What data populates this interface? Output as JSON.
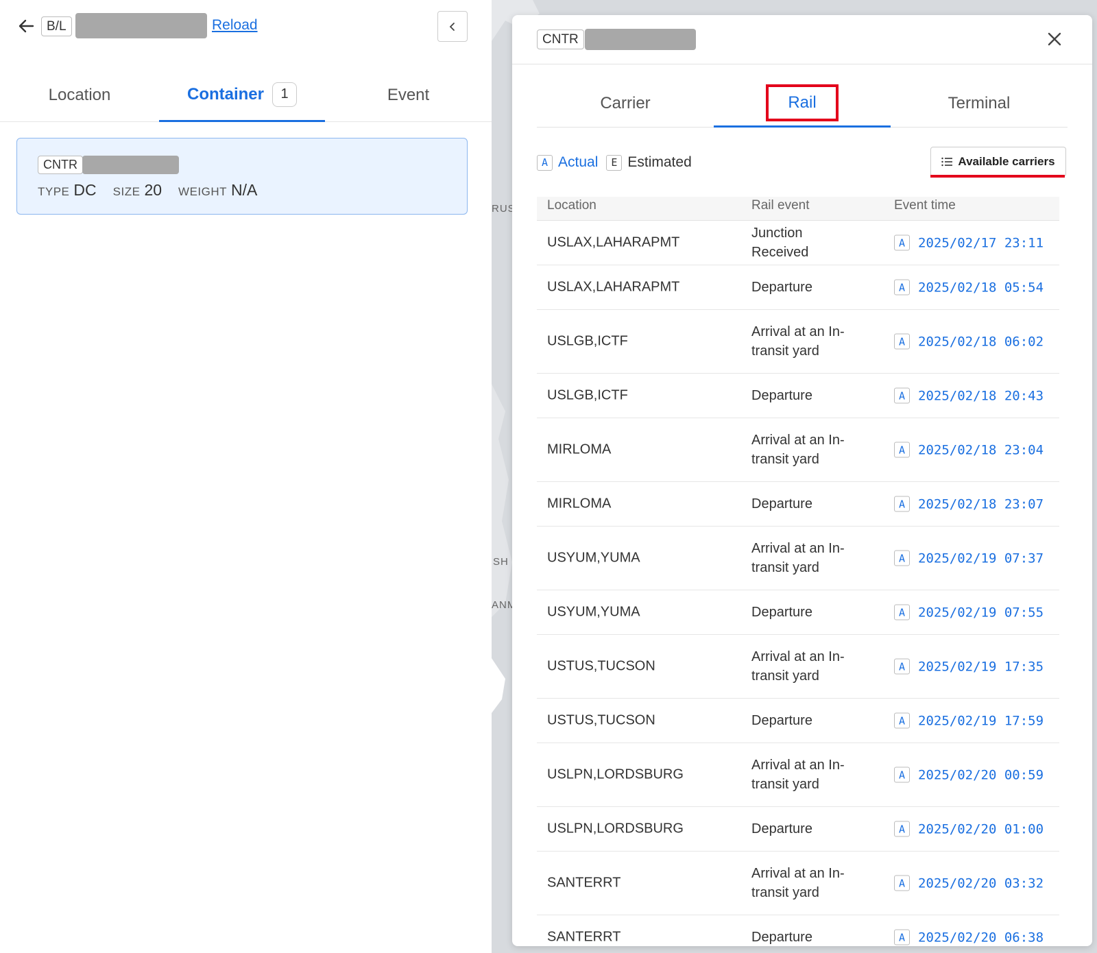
{
  "header": {
    "bl_tag": "B/L",
    "reload_label": "Reload"
  },
  "left_tabs": [
    {
      "label": "Location"
    },
    {
      "label": "Container",
      "count": "1"
    },
    {
      "label": "Event"
    }
  ],
  "container_card": {
    "tag": "CNTR",
    "type_key": "TYPE",
    "type_val": "DC",
    "size_key": "SIZE",
    "size_val": "20",
    "weight_key": "WEIGHT",
    "weight_val": "N/A"
  },
  "map_labels": [
    "RUS",
    "SH",
    "ANM"
  ],
  "drawer": {
    "tag": "CNTR",
    "tabs": [
      "Carrier",
      "Rail",
      "Terminal"
    ],
    "legend": {
      "actual_badge": "A",
      "actual": "Actual",
      "estimated_badge": "E",
      "estimated": "Estimated"
    },
    "available_carriers": "Available carriers",
    "columns": [
      "Location",
      "Rail event",
      "Event time"
    ],
    "rows": [
      {
        "location": "USLAX,LAHARAPMT",
        "event": "Junction Received",
        "badge": "A",
        "time": "2025/02/17 23:11"
      },
      {
        "location": "USLAX,LAHARAPMT",
        "event": "Departure",
        "badge": "A",
        "time": "2025/02/18 05:54"
      },
      {
        "location": "USLGB,ICTF",
        "event": "Arrival at an In-transit yard",
        "badge": "A",
        "time": "2025/02/18 06:02"
      },
      {
        "location": "USLGB,ICTF",
        "event": "Departure",
        "badge": "A",
        "time": "2025/02/18 20:43"
      },
      {
        "location": "MIRLOMA",
        "event": "Arrival at an In-transit yard",
        "badge": "A",
        "time": "2025/02/18 23:04"
      },
      {
        "location": "MIRLOMA",
        "event": "Departure",
        "badge": "A",
        "time": "2025/02/18 23:07"
      },
      {
        "location": "USYUM,YUMA",
        "event": "Arrival at an In-transit yard",
        "badge": "A",
        "time": "2025/02/19 07:37"
      },
      {
        "location": "USYUM,YUMA",
        "event": "Departure",
        "badge": "A",
        "time": "2025/02/19 07:55"
      },
      {
        "location": "USTUS,TUCSON",
        "event": "Arrival at an In-transit yard",
        "badge": "A",
        "time": "2025/02/19 17:35"
      },
      {
        "location": "USTUS,TUCSON",
        "event": "Departure",
        "badge": "A",
        "time": "2025/02/19 17:59"
      },
      {
        "location": "USLPN,LORDSBURG",
        "event": "Arrival at an In-transit yard",
        "badge": "A",
        "time": "2025/02/20 00:59"
      },
      {
        "location": "USLPN,LORDSBURG",
        "event": "Departure",
        "badge": "A",
        "time": "2025/02/20 01:00"
      },
      {
        "location": "SANTERRT",
        "event": "Arrival at an In-transit yard",
        "badge": "A",
        "time": "2025/02/20 03:32"
      },
      {
        "location": "SANTERRT",
        "event": "Departure",
        "badge": "A",
        "time": "2025/02/20 06:38"
      }
    ]
  },
  "colors": {
    "accent": "#1a6fe0",
    "highlight": "#e3001b"
  }
}
